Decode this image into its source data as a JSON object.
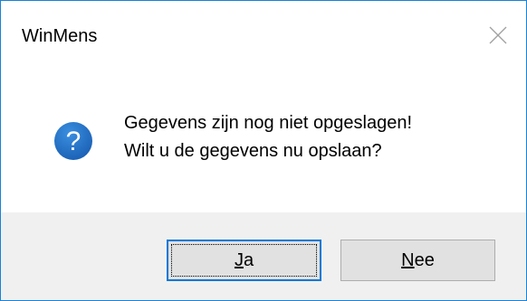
{
  "window": {
    "title": "WinMens"
  },
  "message": {
    "line1": "Gegevens zijn nog niet opgeslagen!",
    "line2": "Wilt u de gegevens nu opslaan?",
    "icon": "question-icon"
  },
  "buttons": {
    "yes": {
      "mnemonic": "J",
      "rest": "a"
    },
    "no": {
      "mnemonic": "N",
      "rest": "ee"
    }
  },
  "colors": {
    "accent": "#0078d7",
    "icon_blue": "#1e6ec8",
    "footer_bg": "#f0f0f0",
    "button_bg": "#e1e1e1"
  }
}
